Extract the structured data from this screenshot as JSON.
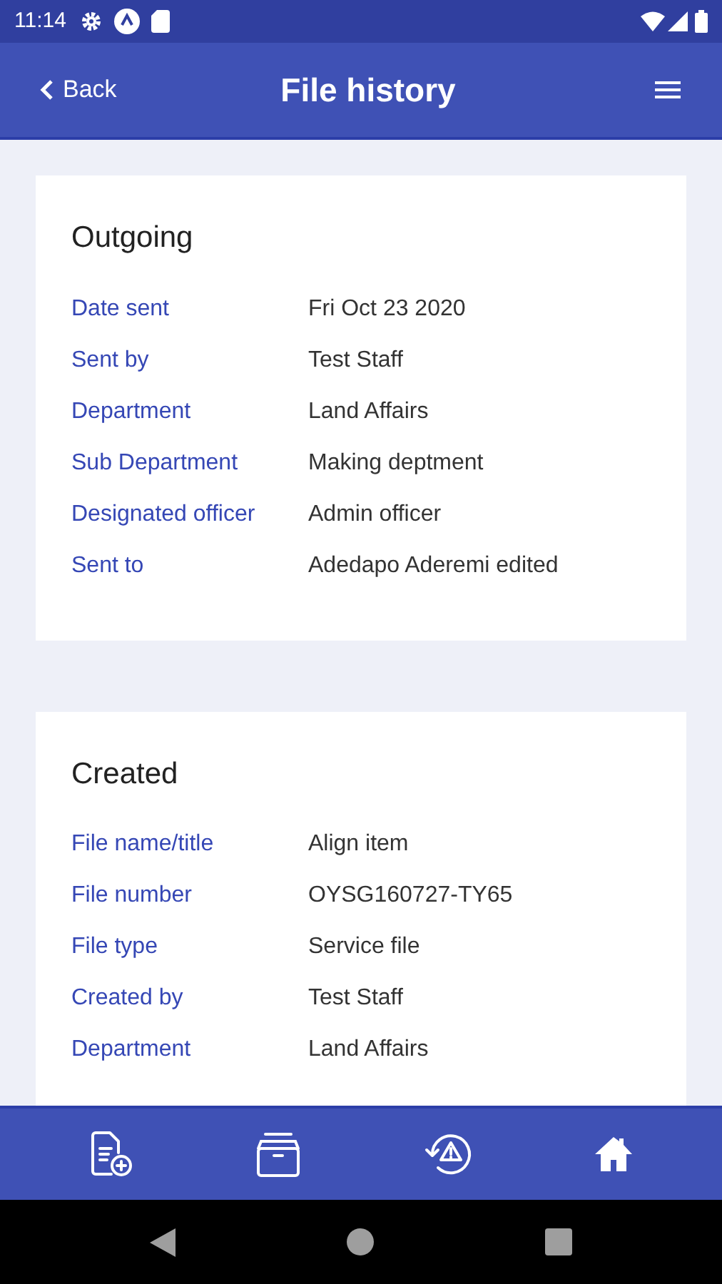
{
  "status_bar": {
    "time": "11:14"
  },
  "app_bar": {
    "back": "Back",
    "title": "File history"
  },
  "sections": [
    {
      "title": "Outgoing",
      "rows": [
        {
          "label": "Date sent",
          "value": "Fri Oct 23 2020"
        },
        {
          "label": "Sent by",
          "value": "Test Staff"
        },
        {
          "label": "Department",
          "value": "Land Affairs"
        },
        {
          "label": "Sub Department",
          "value": "Making deptment"
        },
        {
          "label": "Designated officer",
          "value": "Admin officer"
        },
        {
          "label": "Sent to",
          "value": "Adedapo Aderemi edited"
        }
      ]
    },
    {
      "title": "Created",
      "rows": [
        {
          "label": "File name/title",
          "value": "Align item"
        },
        {
          "label": "File number",
          "value": "OYSG160727-TY65"
        },
        {
          "label": "File type",
          "value": "Service file"
        },
        {
          "label": "Created by",
          "value": "Test Staff"
        },
        {
          "label": "Department",
          "value": "Land Affairs"
        }
      ]
    }
  ],
  "bottom_nav": [
    {
      "kind": "new-file"
    },
    {
      "kind": "archive"
    },
    {
      "kind": "history-alert"
    },
    {
      "kind": "home"
    }
  ]
}
